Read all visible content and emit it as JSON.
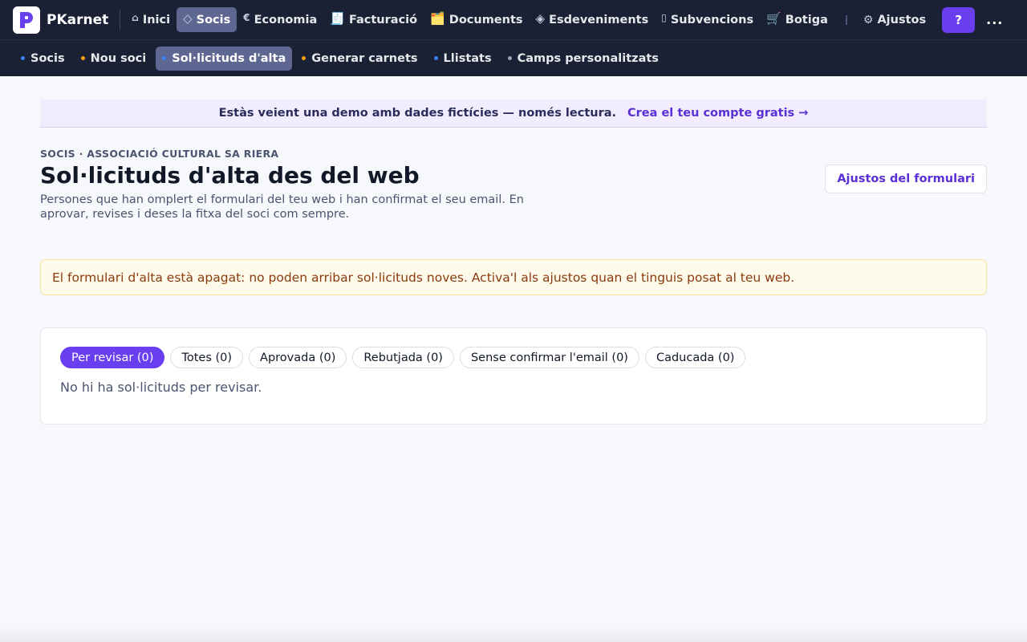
{
  "brand": {
    "name": "PKarnet"
  },
  "nav": {
    "items": [
      {
        "label": "Inici",
        "icon": "⌂"
      },
      {
        "label": "Socis",
        "icon": "◇"
      },
      {
        "label": "Economia",
        "icon": "€"
      },
      {
        "label": "Facturació",
        "icon": "🧾"
      },
      {
        "label": "Documents",
        "icon": "🗂️"
      },
      {
        "label": "Esdeveniments",
        "icon": "◈"
      },
      {
        "label": "Subvencions",
        "icon": "▯"
      },
      {
        "label": "Botiga",
        "icon": "🛒"
      }
    ],
    "settings_label": "Ajustos",
    "settings_icon": "⚙",
    "help_label": "?",
    "more_label": "..."
  },
  "subnav": {
    "items": [
      {
        "label": "Socis",
        "dot_color": "#3b82f6"
      },
      {
        "label": "Nou soci",
        "dot_color": "#f59e0b"
      },
      {
        "label": "Sol·licituds d'alta",
        "dot_color": "#3b82f6"
      },
      {
        "label": "Generar carnets",
        "dot_color": "#f59e0b"
      },
      {
        "label": "Llistats",
        "dot_color": "#3b82f6"
      },
      {
        "label": "Camps personalitzats",
        "dot_color": "#9ca3af"
      }
    ]
  },
  "demo_banner": {
    "text": "Estàs veient una demo amb dades fictícies — només lectura.",
    "link": "Crea el teu compte gratis →"
  },
  "page": {
    "kicker": "SOCIS · ASSOCIACIÓ CULTURAL SA RIERA",
    "title": "Sol·licituds d'alta des del web",
    "subtitle": "Persones que han omplert el formulari del teu web i han confirmat el seu email. En aprovar, revises i deses la fitxa del soci com sempre.",
    "form_settings_button": "Ajustos del formulari"
  },
  "warning": {
    "text": "El formulari d'alta està apagat: no poden arribar sol·licituds noves. Activa'l als ajustos quan el tinguis posat al teu web."
  },
  "filters": [
    {
      "label": "Per revisar (0)"
    },
    {
      "label": "Totes (0)"
    },
    {
      "label": "Aprovada (0)"
    },
    {
      "label": "Rebutjada (0)"
    },
    {
      "label": "Sense confirmar l'email (0)"
    },
    {
      "label": "Caducada (0)"
    }
  ],
  "empty_message": "No hi ha sol·licituds per revisar.",
  "colors": {
    "nav_bg": "#1a2135",
    "accent": "#6a3ff0",
    "warning_bg": "#fffbeb",
    "warning_text": "#8b3a0e"
  }
}
